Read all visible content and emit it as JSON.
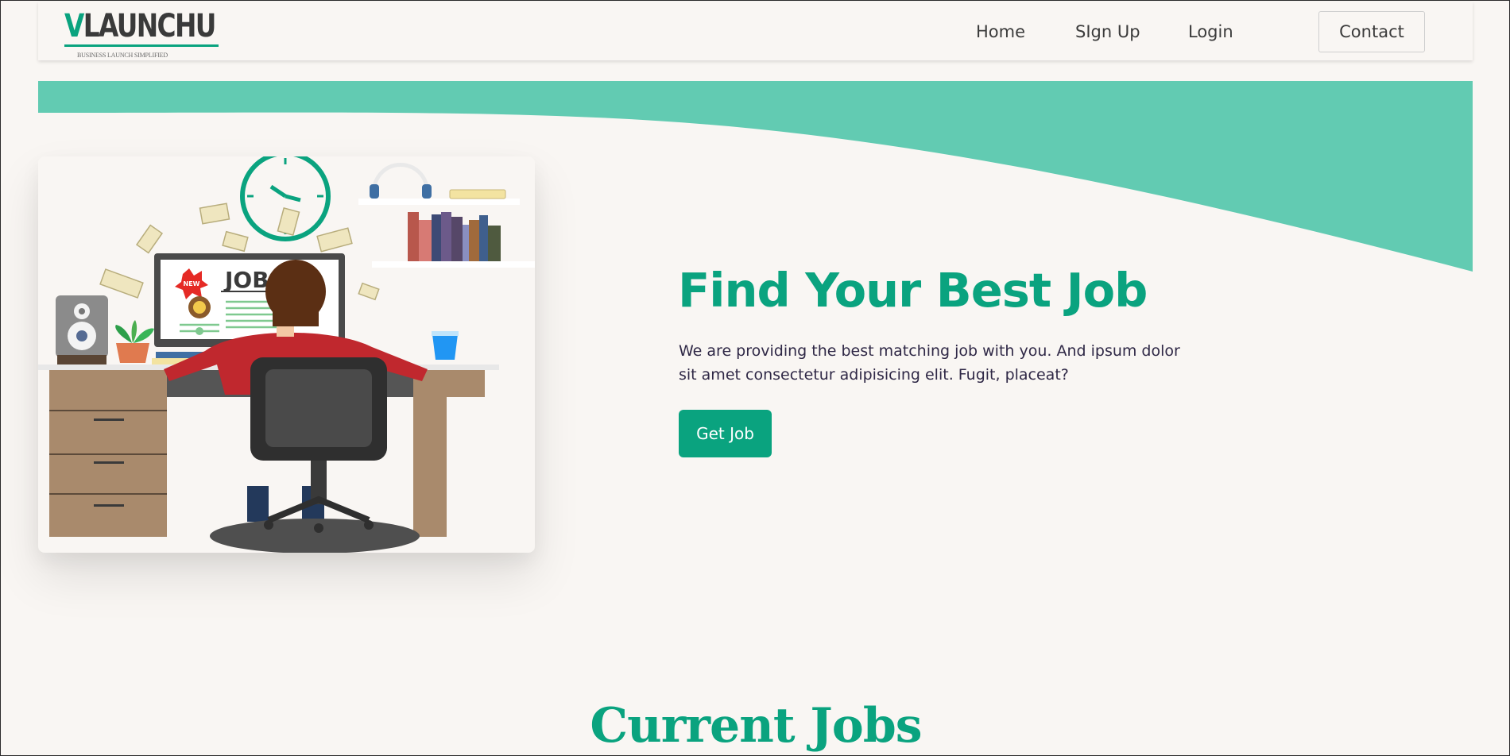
{
  "brand": {
    "logo_text_v": "V",
    "logo_text_rest": "LAUNCHU",
    "tagline": "BUSINESS LAUNCH SIMPLIFIED",
    "primary_color": "#0aa37f",
    "wave_color": "#62cbb2"
  },
  "nav": {
    "links": [
      {
        "label": "Home"
      },
      {
        "label": "SIgn Up"
      },
      {
        "label": "Login"
      }
    ],
    "contact_label": "Contact"
  },
  "hero": {
    "title": "Find Your Best Job",
    "description": "We are providing the best matching job with you. And ipsum dolor sit amet consectetur adipisicing elit. Fugit, placeat?",
    "cta_label": "Get Job",
    "illustration": {
      "screen_word": "JOBS",
      "badge_text": "NEW"
    }
  },
  "section": {
    "title": "Current Jobs"
  }
}
